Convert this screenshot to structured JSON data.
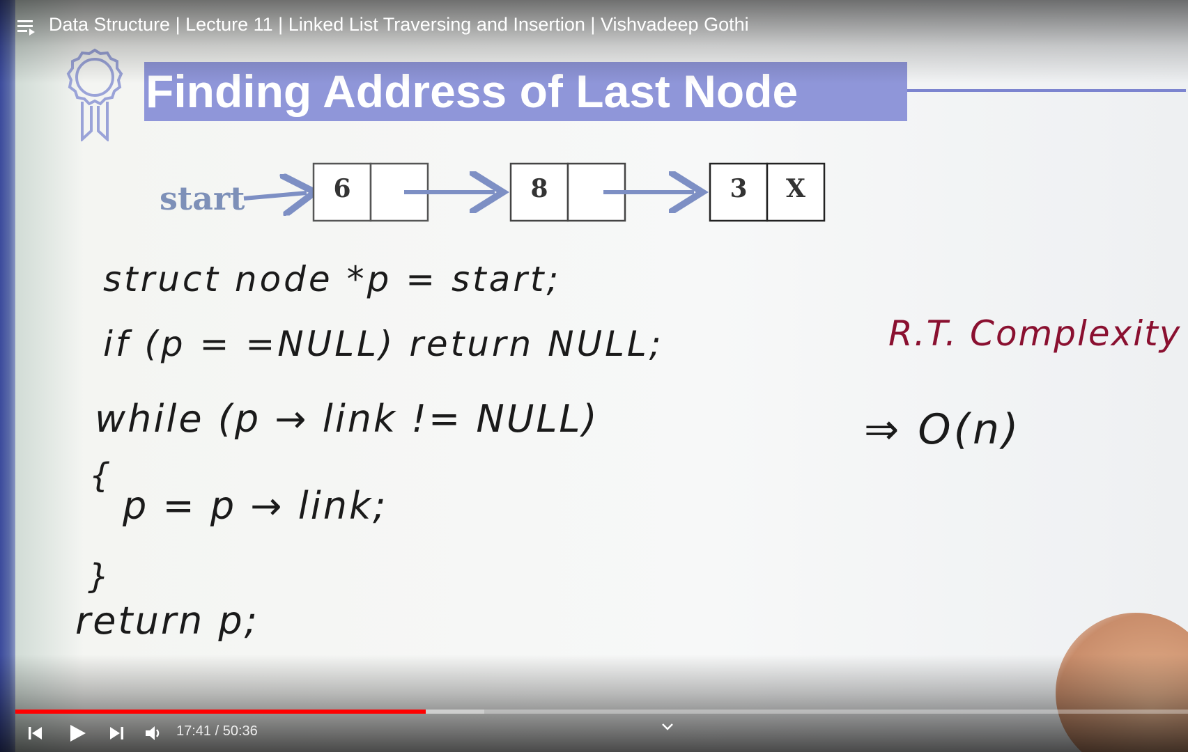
{
  "window": {
    "video_title": "Data Structure | Lecture 11 | Linked List Traversing and Insertion | Vishvadeep Gothi"
  },
  "slide": {
    "heading": "Finding Address of Last Node",
    "diagram": {
      "start_label": "start",
      "nodes": [
        {
          "value": "6",
          "next": ""
        },
        {
          "value": "8",
          "next": ""
        },
        {
          "value": "3",
          "next": "X"
        }
      ]
    },
    "code_lines": [
      "struct node *p = start;",
      "if (p = =NULL) return NULL;",
      "while (p → link != NULL)",
      "{",
      "p = p → link;",
      "}",
      "return p;"
    ],
    "annotation": {
      "label": "R.T. Complexity",
      "value": "⇒ O(n)"
    }
  },
  "player": {
    "current_time": "17:41",
    "duration": "50:36",
    "time_display": "17:41 / 50:36",
    "progress_fraction": 0.3497,
    "buffered_fraction": 0.4
  },
  "icons": [
    "playlist-icon",
    "previous-icon",
    "play-icon",
    "next-icon",
    "volume-icon",
    "chevron-down-icon",
    "badge-icon"
  ],
  "colors": {
    "heading_bg": "#8f96d9",
    "progress_played": "#ff0000",
    "annotation": "#8a1030",
    "arrow": "#7d8fc4"
  }
}
